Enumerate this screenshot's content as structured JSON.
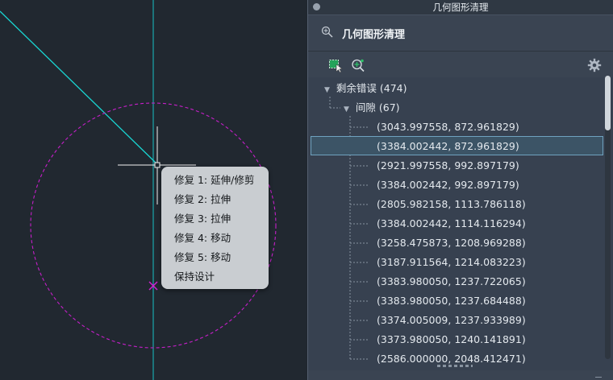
{
  "palette": {
    "window_title": "几何图形清理",
    "header_title": "几何图形清理",
    "icons": {
      "header": "geometry-cleanup-icon",
      "select": "select-objects-icon",
      "zoom": "zoom-to-error-icon",
      "settings": "gear-icon"
    },
    "tree": {
      "root_label": "剩余错误 (474)",
      "group_label": "间隙 (67)",
      "items": [
        "(3043.997558, 872.961829)",
        "(3384.002442, 872.961829)",
        "(2921.997558, 992.897179)",
        "(3384.002442, 992.897179)",
        "(2805.982158, 1113.786118)",
        "(3384.002442, 1114.116294)",
        "(3258.475873, 1208.969288)",
        "(3187.911564, 1214.083223)",
        "(3383.980050, 1237.722065)",
        "(3383.980050, 1237.684488)",
        "(3374.005009, 1237.933989)",
        "(3373.980050, 1240.141891)",
        "(2586.000000, 2048.412471)"
      ],
      "selected_index": 1
    }
  },
  "context_menu": {
    "items": [
      "修复 1: 延伸/修剪",
      "修复 2: 拉伸",
      "修复 3: 拉伸",
      "修复 4: 移动",
      "修复 5: 移动",
      "保持设计"
    ]
  },
  "colors": {
    "canvas_bg": "#212830",
    "cyan_line": "#17d3d3",
    "magenta": "#cc22cc",
    "selection": "#3c5466"
  }
}
